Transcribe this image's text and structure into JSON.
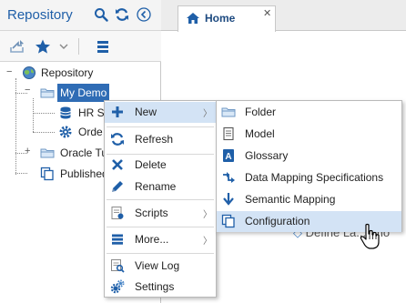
{
  "left_panel": {
    "title": "Repository",
    "header_icons": [
      "search-icon",
      "refresh-icon",
      "collapse-left-icon"
    ],
    "toolbar_icons": [
      "import-icon",
      "favorite-star-icon",
      "dropdown-arrow-icon",
      "list-menu-icon"
    ]
  },
  "tree": {
    "root_label": "Repository",
    "items": [
      {
        "label": "My Demo",
        "icon": "folder-icon",
        "selected": true
      },
      {
        "label": "HR S",
        "icon": "database-icon"
      },
      {
        "label": "Orde",
        "icon": "gear-icon"
      },
      {
        "label": "Oracle Tu",
        "icon": "folder-icon"
      },
      {
        "label": "Published",
        "icon": "published-icon"
      }
    ]
  },
  "right_panel": {
    "tab_label": "Home",
    "tab_close": "✕",
    "obscured_text": "Define La... (mo"
  },
  "context_menu": {
    "items": [
      {
        "label": "New",
        "icon": "plus-icon",
        "submenu": true,
        "highlighted": true
      },
      {
        "label": "Refresh",
        "icon": "refresh-icon"
      },
      {
        "label": "Delete",
        "icon": "delete-x-icon"
      },
      {
        "label": "Rename",
        "icon": "pencil-icon"
      },
      {
        "label": "Scripts",
        "icon": "script-icon",
        "submenu": true
      },
      {
        "label": "More...",
        "icon": "list-icon",
        "submenu": true
      },
      {
        "label": "View Log",
        "icon": "view-log-icon"
      },
      {
        "label": "Settings",
        "icon": "settings-gear-icon"
      }
    ]
  },
  "submenu": {
    "items": [
      {
        "label": "Folder",
        "icon": "folder-icon"
      },
      {
        "label": "Model",
        "icon": "model-doc-icon"
      },
      {
        "label": "Glossary",
        "icon": "glossary-icon"
      },
      {
        "label": "Data Mapping Specifications",
        "icon": "data-mapping-icon"
      },
      {
        "label": "Semantic Mapping",
        "icon": "semantic-mapping-icon"
      },
      {
        "label": "Configuration",
        "icon": "configuration-icon",
        "highlighted": true
      }
    ]
  },
  "colors": {
    "accent_blue": "#1f5fa8",
    "selection_blue": "#2f6cb5",
    "menu_highlight": "#d3e3f5"
  }
}
